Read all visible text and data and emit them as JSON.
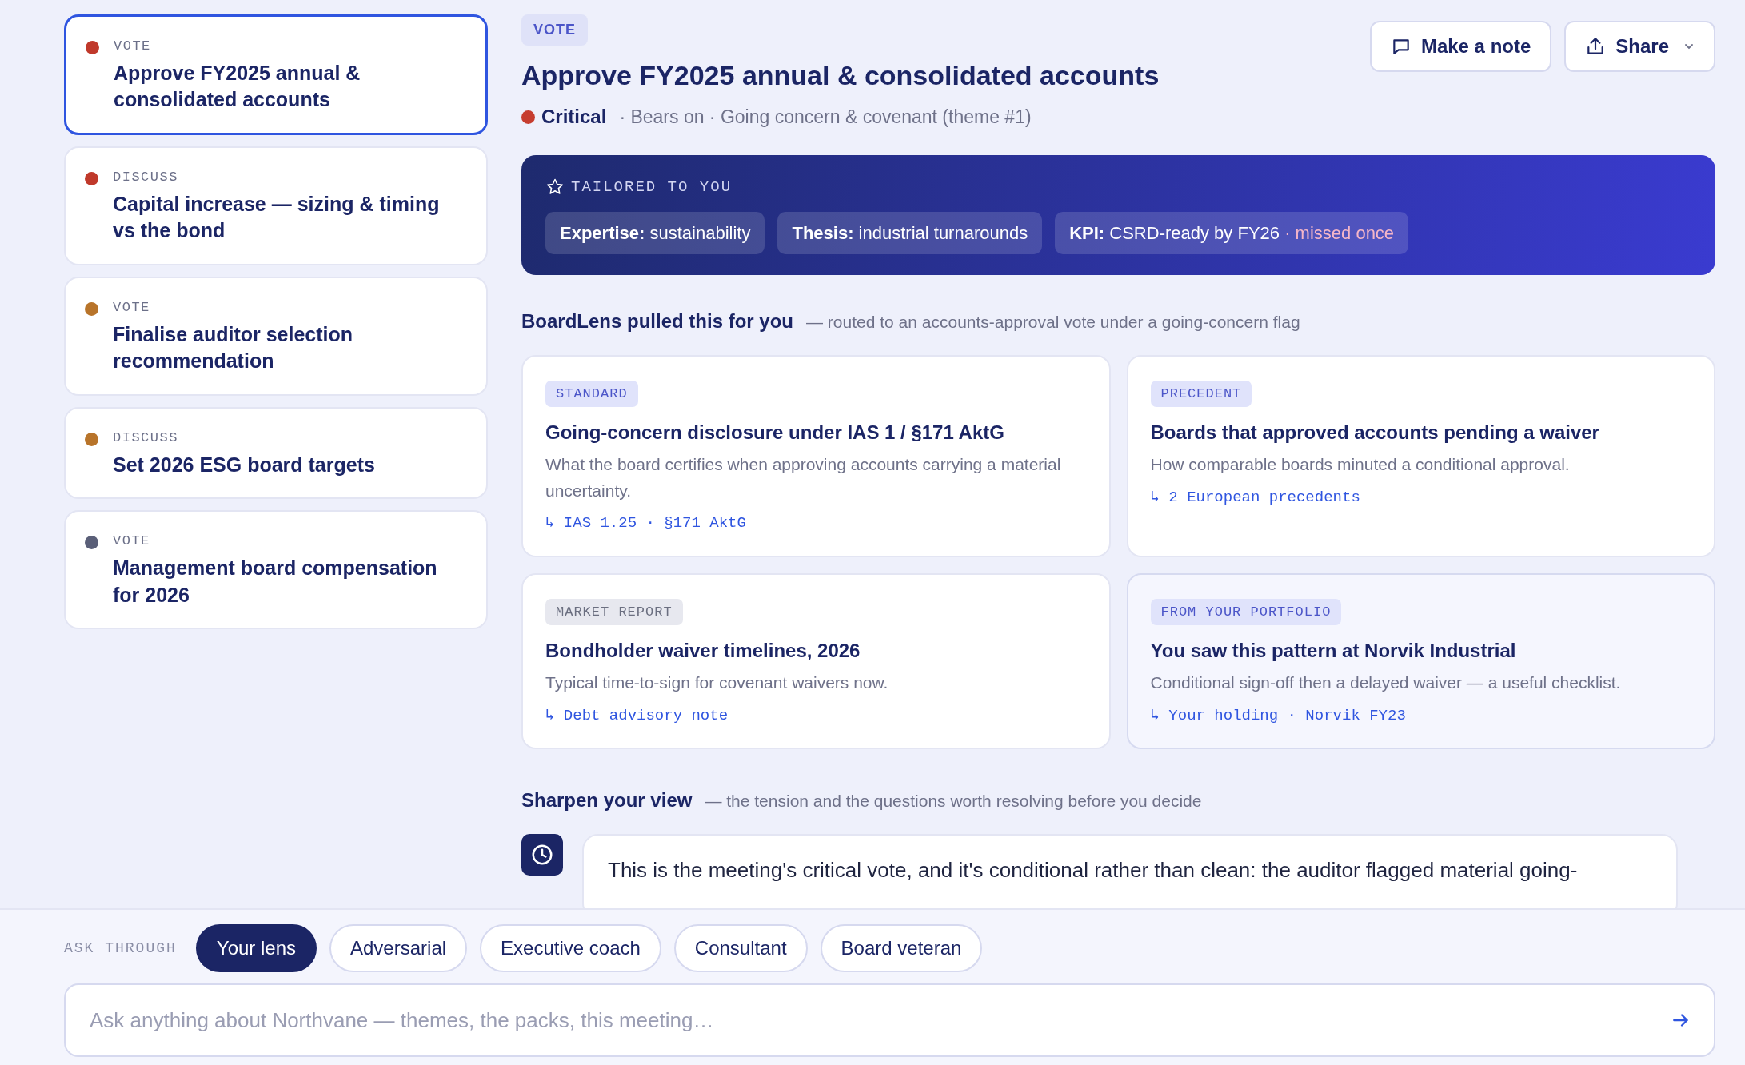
{
  "agenda": [
    {
      "type_label": "VOTE",
      "title": "Approve FY2025 annual & consolidated accounts",
      "color": "#c0392b",
      "selected": true
    },
    {
      "type_label": "DISCUSS",
      "title": "Capital increase — sizing & timing vs the bond",
      "color": "#c0392b",
      "selected": false
    },
    {
      "type_label": "VOTE",
      "title": "Finalise auditor selection recommendation",
      "color": "#b8742a",
      "selected": false
    },
    {
      "type_label": "DISCUSS",
      "title": "Set 2026 ESG board targets",
      "color": "#b8742a",
      "selected": false
    },
    {
      "type_label": "VOTE",
      "title": "Management board compensation for 2026",
      "color": "#5a5f78",
      "selected": false
    }
  ],
  "header": {
    "badge": "VOTE",
    "title": "Approve FY2025 annual & consolidated accounts",
    "severity": {
      "label": "Critical",
      "color": "#c63d2f"
    },
    "context": "· Bears on · Going concern & covenant (theme #1)"
  },
  "actions": [
    {
      "kind": "note",
      "label": "Make a note"
    },
    {
      "kind": "share",
      "label": "Share"
    }
  ],
  "tailored": {
    "heading": "TAILORED TO YOU",
    "chips": [
      {
        "key": "Expertise:",
        "value": "sustainability"
      },
      {
        "key": "Thesis:",
        "value": "industrial turnarounds"
      },
      {
        "key": "KPI:",
        "value": "CSRD-ready by FY26",
        "note": "· missed once"
      }
    ]
  },
  "pulled": {
    "heading": "BoardLens pulled this for you",
    "subtitle": "— routed to an accounts-approval vote under a going-concern flag",
    "cards": [
      {
        "kind": "standard",
        "tag": "STANDARD",
        "title": "Going-concern disclosure under IAS 1 / §171 AktG",
        "description": "What the board certifies when approving accounts carrying a material uncertainty.",
        "source": "↳ IAS 1.25 · §171 AktG"
      },
      {
        "kind": "standard",
        "tag": "PRECEDENT",
        "title": "Boards that approved accounts pending a waiver",
        "description": "How comparable boards minuted a conditional approval.",
        "source": "↳ 2 European precedents"
      },
      {
        "kind": "market",
        "tag": "MARKET REPORT",
        "title": "Bondholder waiver timelines, 2026",
        "description": "Typical time-to-sign for covenant waivers now.",
        "source": "↳ Debt advisory note"
      },
      {
        "kind": "portfolio",
        "tag": "FROM YOUR PORTFOLIO",
        "title": "You saw this pattern at Norvik Industrial",
        "description": "Conditional sign-off then a delayed waiver — a useful checklist.",
        "source": "↳ Your holding · Norvik FY23"
      }
    ]
  },
  "sharpen": {
    "heading": "Sharpen your view",
    "subtitle": "— the tension and the questions worth resolving before you decide",
    "message": "This is the meeting's critical vote, and it's conditional rather than clean: the auditor flagged material going-"
  },
  "ask": {
    "label": "ASK THROUGH",
    "lenses": [
      {
        "label": "Your lens",
        "selected": true
      },
      {
        "label": "Adversarial",
        "selected": false
      },
      {
        "label": "Executive coach",
        "selected": false
      },
      {
        "label": "Consultant",
        "selected": false
      },
      {
        "label": "Board veteran",
        "selected": false
      }
    ],
    "input": {
      "placeholder": "Ask anything about Northvane — themes, the packs, this meeting…"
    }
  }
}
